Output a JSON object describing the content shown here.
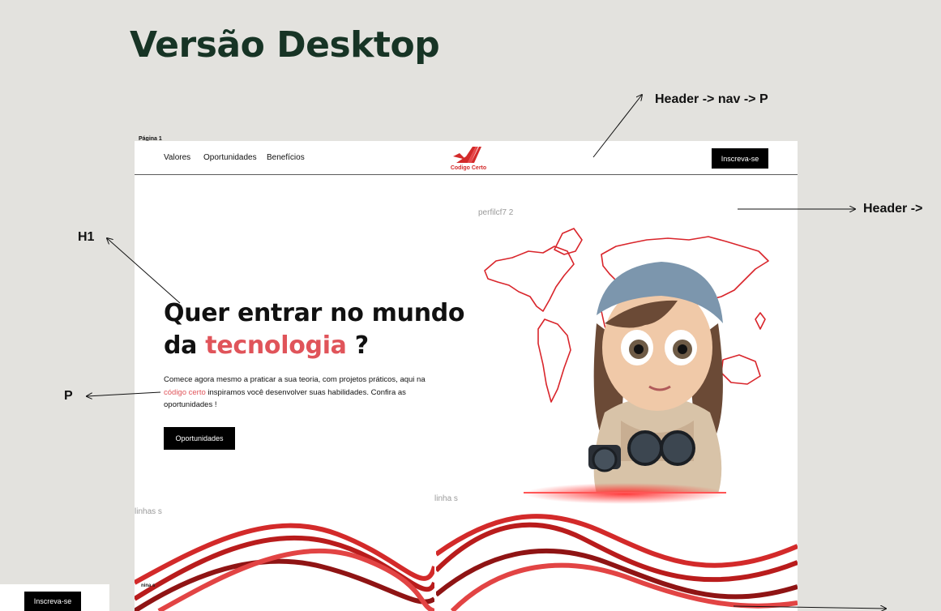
{
  "page": {
    "title": "Versão Desktop"
  },
  "annotations": {
    "nav_p": "Header -> nav -> P",
    "header": "Header ->",
    "h1": "H1",
    "p": "P"
  },
  "frame": {
    "label": "Página 1",
    "nav": {
      "links": [
        "Valores",
        "Oportunidades",
        "Benefícios"
      ],
      "logo_text": "Codigo Certo",
      "cta_label": "Inscreva-se"
    },
    "hero": {
      "heading_line1": "Quer entrar no mundo",
      "heading_prefix": "da",
      "heading_highlight": "tecnologia",
      "heading_suffix": "?",
      "paragraph_part1": "Comece agora mesmo a praticar a sua teoria, com projetos práticos, aqui na",
      "paragraph_link": "código certo",
      "paragraph_part2": "inspiramos você desenvolver suas habilidades. Confira as oportunidades !",
      "cta_label": "Oportunidades",
      "image_label": "perfilcf7 2"
    },
    "decor": {
      "lines_left_label": "linhas s",
      "lines_right_label": "linha s",
      "mini_label": "nina s"
    }
  },
  "bottom": {
    "cta_label": "Inscreva-se"
  },
  "colors": {
    "accent": "#e0545a",
    "heading": "#173425",
    "brand_red": "#d32a2a"
  }
}
